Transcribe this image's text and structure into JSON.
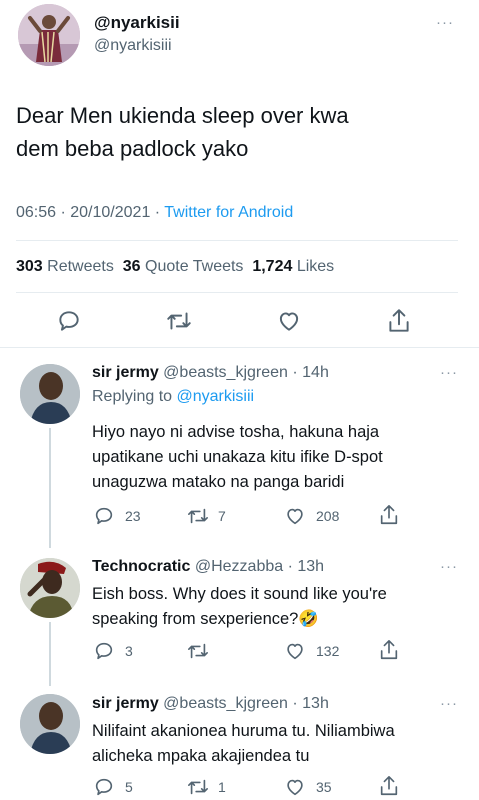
{
  "main_tweet": {
    "display_name": "@nyarkisii",
    "handle": "@nyarkisiii",
    "more": "···",
    "text_line1": "Dear Men ukienda sleep over kwa",
    "text_line2": "dem beba padlock yako",
    "time": "06:56 · 20/10/2021 ·",
    "source": "Twitter for Android",
    "stats": {
      "retweets_count": "303",
      "retweets_label": "Retweets",
      "quotes_count": "36",
      "quotes_label": "Quote Tweets",
      "likes_count": "1,724",
      "likes_label": "Likes"
    }
  },
  "replies": [
    {
      "name": "sir jermy",
      "handle_time": "@beasts_kjgreen · 14h",
      "replying_prefix": "Replying to",
      "replying_to": "@nyarkisiii",
      "line1": "Hiyo nayo ni advise tosha, hakuna haja",
      "line2": "upatikane uchi unakaza kitu ifike D-spot",
      "line3": "unaguzwa matako na panga baridi",
      "reply_count": "23",
      "retweet_count": "7",
      "like_count": "208",
      "more": "···"
    },
    {
      "name": "Technocratic",
      "handle_time": "@Hezzabba · 13h",
      "line1": "Eish boss. Why does it sound like you're",
      "line2": "speaking from sexperience?",
      "emoji": "🤣",
      "reply_count": "3",
      "retweet_count": "",
      "like_count": "132",
      "more": "···"
    },
    {
      "name": "sir jermy",
      "handle_time": "@beasts_kjgreen · 13h",
      "line1": "Nilifaint akanionea huruma tu. Niliambiwa",
      "line2": "alicheka mpaka akajiendea tu",
      "reply_count": "5",
      "retweet_count": "1",
      "like_count": "35",
      "more": "···"
    }
  ],
  "colors": {
    "accent": "#1d9bf0",
    "text": "#0f1419",
    "muted": "#536471",
    "divider": "#e6ecf0"
  }
}
